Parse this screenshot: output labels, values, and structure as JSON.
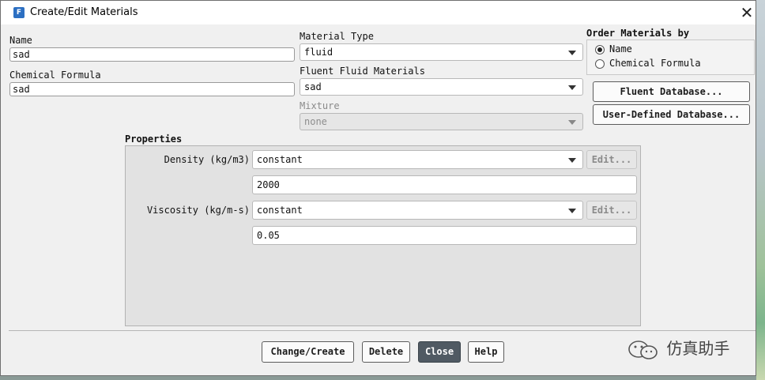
{
  "window": {
    "title": "Create/Edit Materials",
    "app_icon_letter": "F"
  },
  "fields": {
    "name_label": "Name",
    "name_value": "sad",
    "chemical_formula_label": "Chemical Formula",
    "chemical_formula_value": "sad",
    "material_type_label": "Material Type",
    "material_type_value": "fluid",
    "fluent_fluid_materials_label": "Fluent Fluid Materials",
    "fluent_fluid_materials_value": "sad",
    "mixture_label": "Mixture",
    "mixture_value": "none"
  },
  "order": {
    "title": "Order Materials by",
    "options": [
      {
        "label": "Name",
        "checked": true
      },
      {
        "label": "Chemical Formula",
        "checked": false
      }
    ]
  },
  "database_buttons": {
    "fluent": "Fluent Database...",
    "user_defined": "User-Defined Database..."
  },
  "properties": {
    "title": "Properties",
    "density": {
      "label": "Density (kg/m3)",
      "method": "constant",
      "edit": "Edit...",
      "value": "2000"
    },
    "viscosity": {
      "label": "Viscosity (kg/m-s)",
      "method": "constant",
      "edit": "Edit...",
      "value": "0.05"
    }
  },
  "footer": {
    "change_create": "Change/Create",
    "delete": "Delete",
    "close": "Close",
    "help": "Help"
  },
  "watermark": {
    "text": "仿真助手"
  }
}
